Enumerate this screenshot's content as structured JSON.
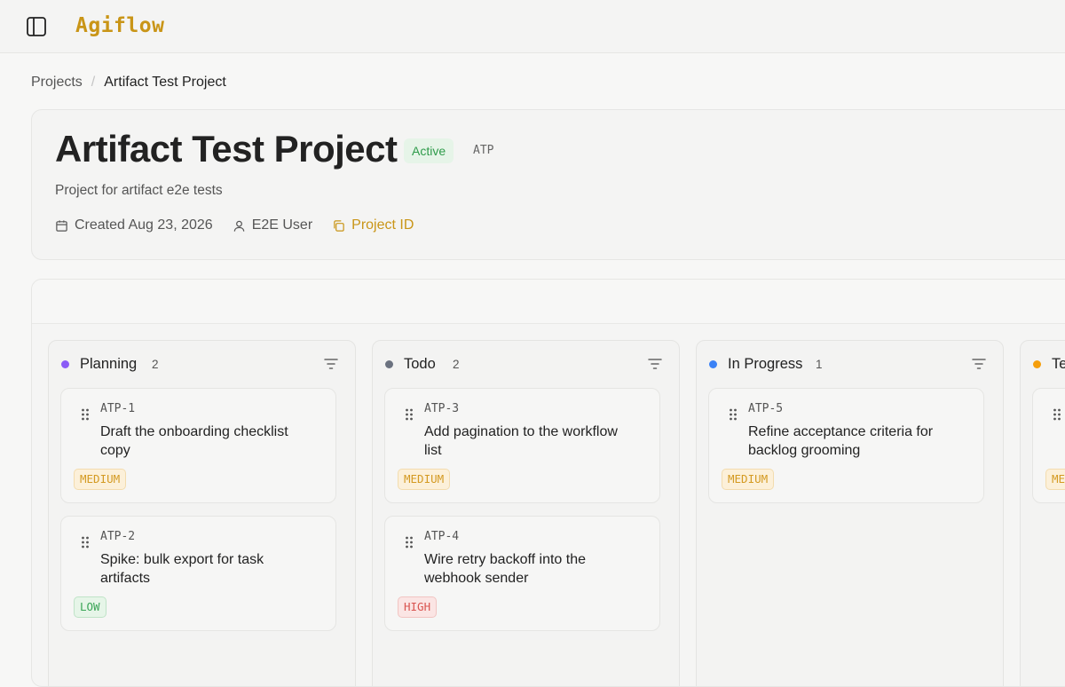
{
  "app": {
    "logo_text": "Agiflow"
  },
  "breadcrumb": {
    "root": "Projects",
    "separator": "/",
    "current": "Artifact Test Project"
  },
  "project": {
    "title": "Artifact Test Project",
    "status": "Active",
    "key": "ATP",
    "description": "Project for artifact e2e tests",
    "created": "Created Aug 23, 2026",
    "owner": "E2E User",
    "project_id_label": "Project ID"
  },
  "colors": {
    "brand": "#c99517",
    "planning": "#8b5cf6",
    "todo": "#6b7280",
    "in_progress": "#3b82f6",
    "testing": "#f59e0b"
  },
  "columns": [
    {
      "title": "Planning",
      "count": "2",
      "tasks": [
        {
          "key": "ATP-1",
          "title": "Draft the onboarding checklist copy",
          "priority": "MEDIUM"
        },
        {
          "key": "ATP-2",
          "title": "Spike: bulk export for task artifacts",
          "priority": "LOW"
        }
      ]
    },
    {
      "title": "Todo",
      "count": "2",
      "tasks": [
        {
          "key": "ATP-3",
          "title": "Add pagination to the workflow list",
          "priority": "MEDIUM"
        },
        {
          "key": "ATP-4",
          "title": "Wire retry backoff into the webhook sender",
          "priority": "HIGH"
        }
      ]
    },
    {
      "title": "In Progress",
      "count": "1",
      "tasks": [
        {
          "key": "ATP-5",
          "title": "Refine acceptance criteria for backlog grooming",
          "priority": "MEDIUM"
        }
      ]
    },
    {
      "title": "Te",
      "count": "",
      "tasks": [
        {
          "key": "",
          "title": "",
          "priority": "ME"
        }
      ]
    }
  ]
}
